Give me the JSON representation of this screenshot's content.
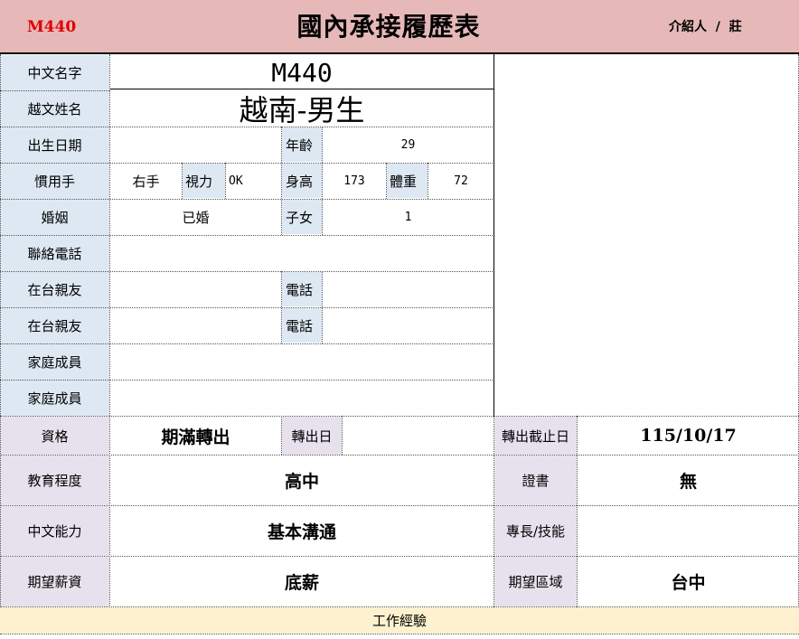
{
  "header": {
    "code": "M440",
    "title": "國內承接履歷表",
    "introducer_label": "介紹人",
    "introducer_sep": "/",
    "introducer_name": "莊"
  },
  "labels": {
    "chinese_name": "中文名字",
    "vietnamese_name": "越文姓名",
    "birth_date": "出生日期",
    "age": "年齡",
    "handedness": "慣用手",
    "vision": "視力",
    "height": "身高",
    "weight": "體重",
    "marriage": "婚姻",
    "children": "子女",
    "phone": "聯絡電話",
    "relatives_1": "在台親友",
    "relatives_2": "在台親友",
    "rel_phone_1": "電話",
    "rel_phone_2": "電話",
    "family_1": "家庭成員",
    "family_2": "家庭成員",
    "qualification": "資格",
    "transfer_date": "轉出日",
    "transfer_deadline": "轉出截止日",
    "education": "教育程度",
    "certificate": "證書",
    "chinese_ability": "中文能力",
    "specialty": "專長/技能",
    "expected_salary": "期望薪資",
    "expected_area": "期望區域"
  },
  "values": {
    "chinese_name": "M440",
    "vietnamese_name": "越南-男生",
    "birth_date": "",
    "age": "29",
    "handedness": "右手",
    "vision": "OK",
    "height": "173",
    "weight": "72",
    "marriage": "已婚",
    "children": "1",
    "phone": "",
    "qualification": "期滿轉出",
    "transfer_date": "",
    "transfer_deadline": "115/10/17",
    "education": "高中",
    "certificate": "無",
    "chinese_ability": "基本溝通",
    "specialty": "",
    "expected_salary": "底薪",
    "expected_area": "台中"
  },
  "footer": {
    "work_experience": "工作經驗"
  },
  "colors": {
    "header_bg": "#e6b8b8",
    "code_red": "#e00000",
    "label_blue": "#dde8f3",
    "label_lavender": "#e7e1ed",
    "footer_yellow": "#fdf1cf"
  }
}
